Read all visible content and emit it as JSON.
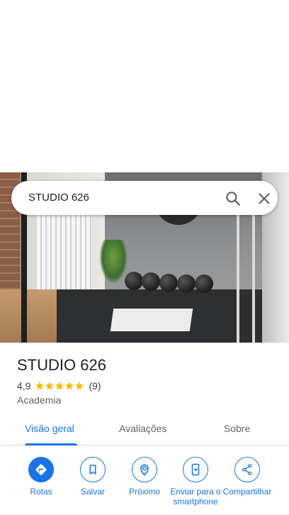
{
  "search": {
    "query": "STUDIO 626"
  },
  "place": {
    "name": "STUDIO 626",
    "rating": "4,9",
    "star_count": 5,
    "review_count": "(9)",
    "category": "Academia"
  },
  "tabs": [
    {
      "label": "Visão geral"
    },
    {
      "label": "Avaliações"
    },
    {
      "label": "Sobre"
    }
  ],
  "actions": [
    {
      "label": "Rotas",
      "icon": "directions-icon"
    },
    {
      "label": "Salvar",
      "icon": "bookmark-icon"
    },
    {
      "label": "Próximo",
      "icon": "nearby-icon"
    },
    {
      "label": "Enviar para o smartphone",
      "icon": "send-to-phone-icon"
    },
    {
      "label": "Compartilhar",
      "icon": "share-icon"
    }
  ],
  "colors": {
    "accent": "#1a73e8",
    "star": "#fbbc04",
    "text": "#202124",
    "muted": "#5f6368"
  }
}
